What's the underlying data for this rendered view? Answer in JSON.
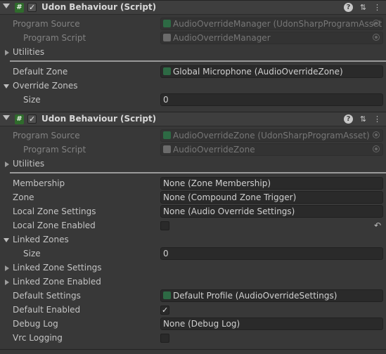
{
  "component1": {
    "title": "Udon Behaviour (Script)",
    "program_source_label": "Program Source",
    "program_source_value": "AudioOverrideManager (UdonSharpProgramAsset)",
    "program_script_label": "Program Script",
    "program_script_value": "AudioOverrideManager",
    "utilities_label": "Utilities",
    "default_zone_label": "Default Zone",
    "default_zone_value": "Global Microphone (AudioOverrideZone)",
    "override_zones_label": "Override Zones",
    "size_label": "Size",
    "size_value": "0"
  },
  "component2": {
    "title": "Udon Behaviour (Script)",
    "program_source_label": "Program Source",
    "program_source_value": "AudioOverrideZone (UdonSharpProgramAsset)",
    "program_script_label": "Program Script",
    "program_script_value": "AudioOverrideZone",
    "utilities_label": "Utilities",
    "membership_label": "Membership",
    "membership_value": "None (Zone Membership)",
    "zone_label": "Zone",
    "zone_value": "None (Compound Zone Trigger)",
    "local_zone_settings_label": "Local Zone Settings",
    "local_zone_settings_value": "None (Audio Override Settings)",
    "local_zone_enabled_label": "Local Zone Enabled",
    "local_zone_enabled_checked": false,
    "linked_zones_label": "Linked Zones",
    "size_label": "Size",
    "size_value": "0",
    "linked_zone_settings_label": "Linked Zone Settings",
    "linked_zone_enabled_label": "Linked Zone Enabled",
    "default_settings_label": "Default Settings",
    "default_settings_value": "Default Profile (AudioOverrideSettings)",
    "default_enabled_label": "Default Enabled",
    "default_enabled_checked": true,
    "debug_log_label": "Debug Log",
    "debug_log_value": "None (Debug Log)",
    "vrc_logging_label": "Vrc Logging",
    "vrc_logging_checked": false
  },
  "icons": {
    "header_enabled_check": "✓",
    "script_icon": "#",
    "help_icon": "?",
    "settings_icon": "⇅",
    "menu_icon": "⋮",
    "revert_icon": "↶"
  }
}
